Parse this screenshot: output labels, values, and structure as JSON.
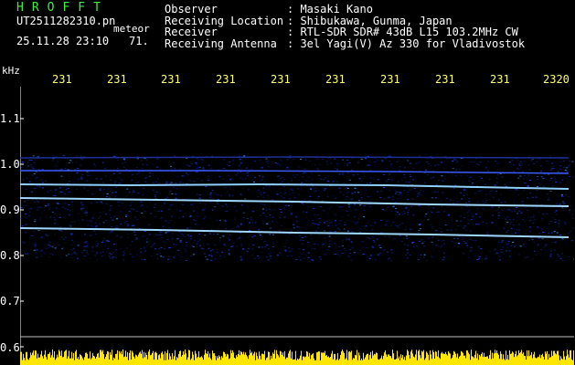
{
  "header": {
    "station_tag": "HROFFT",
    "filename": "UT2511282310.pn",
    "mode": "meteor",
    "datetime": "25.11.28 23:10",
    "count": "71."
  },
  "info": [
    {
      "label": "Observer",
      "value": ": Masaki Kano"
    },
    {
      "label": "Receiving Location",
      "value": ": Shibukawa, Gunma, Japan"
    },
    {
      "label": "Receiver",
      "value": ": RTL-SDR SDR# 43dB L15 103.2MHz CW"
    },
    {
      "label": "Receiving Antenna",
      "value": ": 3el Yagi(V) Az 330 for Vladivostok"
    }
  ],
  "axis": {
    "y_unit": "kHz",
    "y_labels": [
      "1.1",
      "1.0",
      "0.9",
      "0.8",
      "0.7",
      "0.6"
    ],
    "time_labels": [
      "231",
      "231",
      "231",
      "231",
      "231",
      "231",
      "231",
      "231",
      "231",
      "2320"
    ]
  },
  "colors": {
    "background": "#000000",
    "tag": "#3cf03c",
    "time_label": "#ffff66",
    "noise": "#1a3cff",
    "trace": "#9fd8ff",
    "amplitude": "#ffe600"
  }
}
